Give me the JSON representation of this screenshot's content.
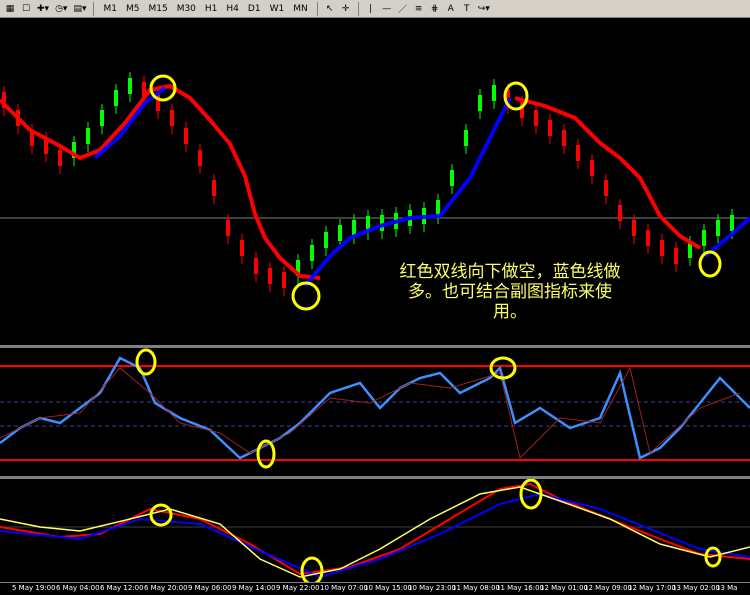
{
  "toolbar": {
    "timeframes": [
      "M1",
      "M5",
      "M15",
      "M30",
      "H1",
      "H4",
      "D1",
      "W1",
      "MN"
    ]
  },
  "annotation": {
    "line1": "红色双线向下做空，蓝色线做",
    "line2": "多。也可结合副图指标来使",
    "line3": "用。"
  },
  "time_axis": [
    "5 May 19:00",
    "6 May 04:00",
    "6 May 12:00",
    "6 May 20:00",
    "9 May 06:00",
    "9 May 14:00",
    "9 May 22:00",
    "10 May 07:00",
    "10 May 15:00",
    "10 May 23:00",
    "11 May 08:00",
    "11 May 16:00",
    "12 May 01:00",
    "12 May 09:00",
    "12 May 17:00",
    "13 May 02:00",
    "13 Ma"
  ],
  "colors": {
    "up": "#00ff00",
    "down": "#ff0000",
    "ma_red": "#ff0000",
    "ma_blue": "#0000ff",
    "highlight": "#ffff00"
  }
}
